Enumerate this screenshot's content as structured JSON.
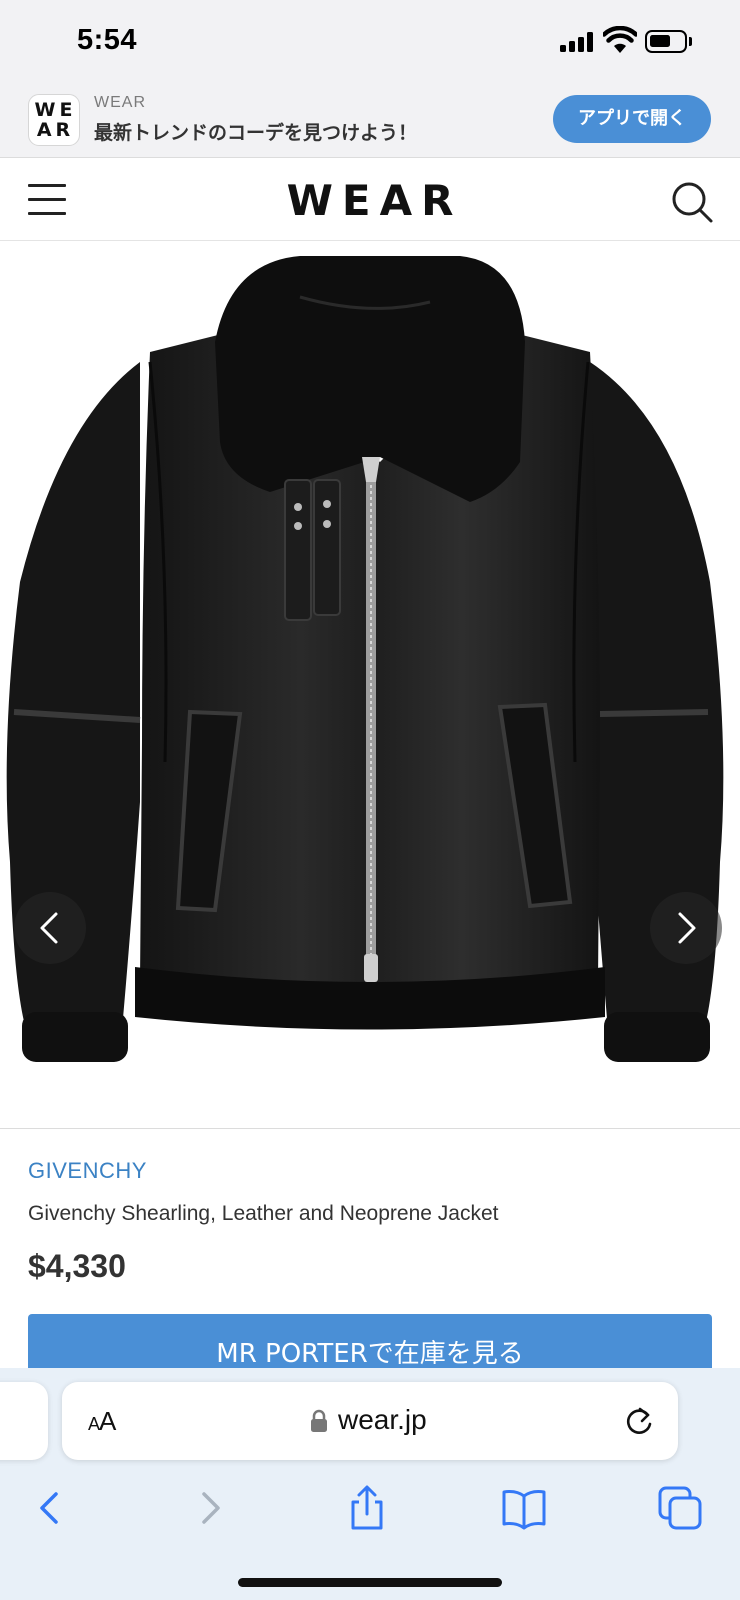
{
  "status_bar": {
    "time": "5:54",
    "icons": [
      "cellular-signal-icon",
      "wifi-icon",
      "battery-icon"
    ]
  },
  "app_banner": {
    "logo_text": "WEAR",
    "app_name": "WEAR",
    "tagline": "最新トレンドのコーデを見つけよう！",
    "open_button": "アプリで開く",
    "accent_color": "#4a8fd6"
  },
  "header": {
    "logo": "WEAR",
    "icons": [
      "hamburger-menu-icon",
      "search-icon"
    ]
  },
  "product": {
    "image_description_icons": [
      "chevron-left-icon",
      "chevron-right-icon"
    ],
    "brand": "GIVENCHY",
    "name": "Givenchy Shearling, Leather and Neoprene Jacket",
    "price": "$4,330",
    "cta": "MR PORTERで在庫を見る",
    "brand_color": "#3b82c4"
  },
  "browser": {
    "text_size_label_small": "A",
    "text_size_label_large": "A",
    "url": "wear.jp",
    "toolbar_icons": [
      "back-icon",
      "forward-icon",
      "share-icon",
      "bookmarks-icon",
      "tabs-icon"
    ]
  }
}
